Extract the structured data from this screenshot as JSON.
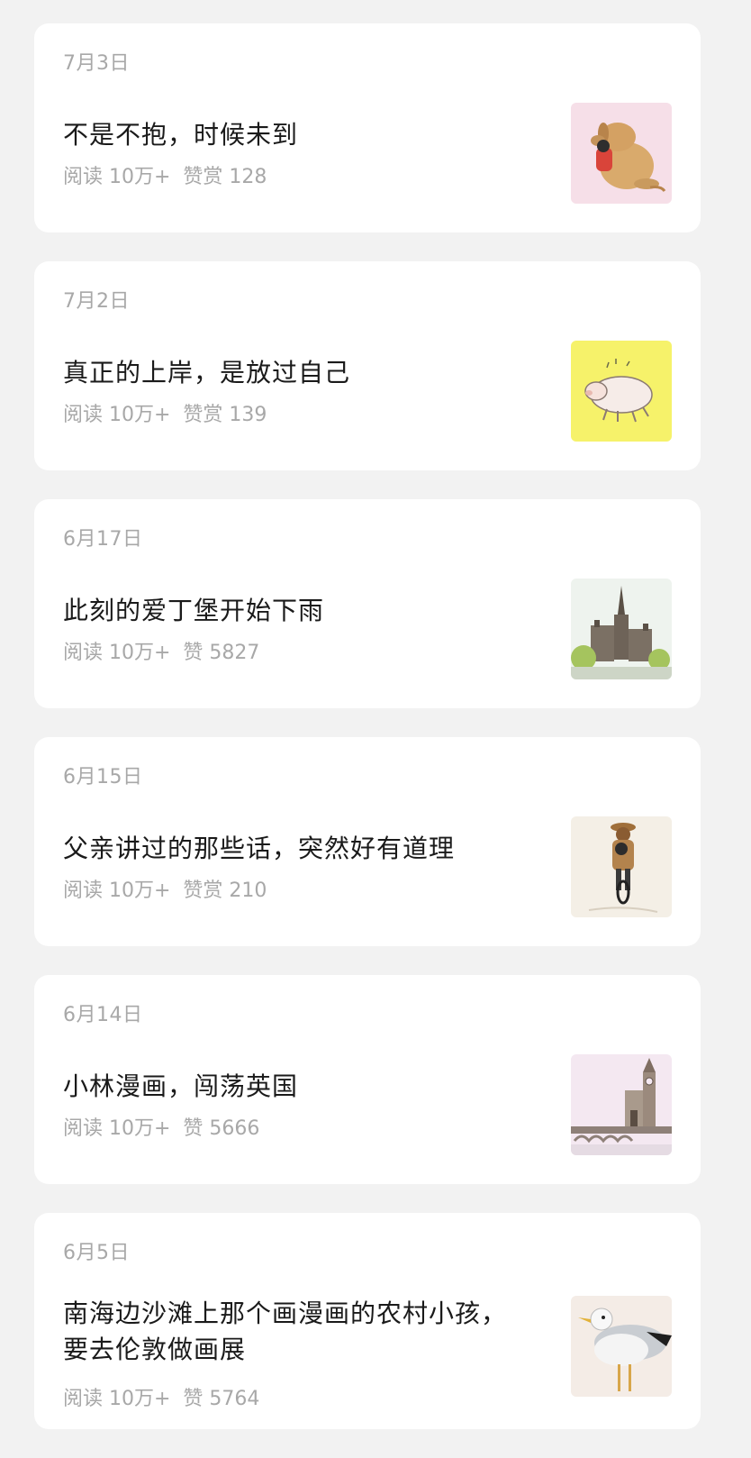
{
  "articles": [
    {
      "date": "7月3日",
      "title": "不是不抱，时候未到",
      "reads": "阅读 10万+",
      "reward": "赞赏 128",
      "thumb_icon": "dog-hug-illustration",
      "thumb_bg": "#f6dfe8"
    },
    {
      "date": "7月2日",
      "title": "真正的上岸，是放过自己",
      "reads": "阅读 10万+",
      "reward": "赞赏 139",
      "thumb_icon": "pig-illustration",
      "thumb_bg": "#f6f26a"
    },
    {
      "date": "6月17日",
      "title": "此刻的爱丁堡开始下雨",
      "reads": "阅读 10万+",
      "reward": "赞 5827",
      "thumb_icon": "edinburgh-illustration",
      "thumb_bg": "#eef3ee"
    },
    {
      "date": "6月15日",
      "title": "父亲讲过的那些话，突然好有道理",
      "reads": "阅读 10万+",
      "reward": "赞赏 210",
      "thumb_icon": "cyclist-illustration",
      "thumb_bg": "#f4efe6"
    },
    {
      "date": "6月14日",
      "title": "小林漫画，闯荡英国",
      "reads": "阅读 10万+",
      "reward": "赞 5666",
      "thumb_icon": "london-bridge-illustration",
      "thumb_bg": "#f4e8f1"
    },
    {
      "date": "6月5日",
      "title": "南海边沙滩上那个画漫画的农村小孩，要去伦敦做画展",
      "reads": "阅读 10万+",
      "reward": "赞 5764",
      "thumb_icon": "seagull-illustration",
      "thumb_bg": "#f4ece6"
    }
  ]
}
